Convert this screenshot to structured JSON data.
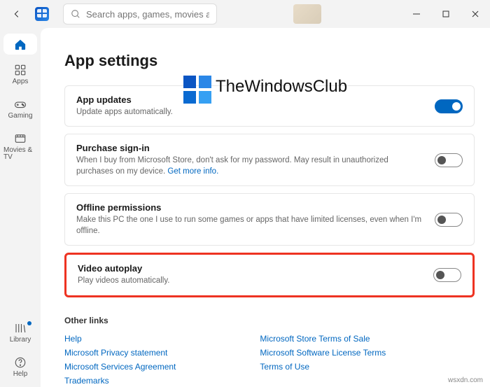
{
  "titlebar": {
    "search_placeholder": "Search apps, games, movies and more"
  },
  "sidebar": {
    "home": "Home",
    "apps": "Apps",
    "gaming": "Gaming",
    "movies": "Movies & TV",
    "library": "Library",
    "help": "Help"
  },
  "page": {
    "title": "App settings"
  },
  "settings": {
    "app_updates": {
      "title": "App updates",
      "desc": "Update apps automatically.",
      "on": true
    },
    "purchase": {
      "title": "Purchase sign-in",
      "desc_pre": "When I buy from Microsoft Store, don't ask for my password. May result in unauthorized purchases on my device. ",
      "link": "Get more info.",
      "on": false
    },
    "offline": {
      "title": "Offline permissions",
      "desc": "Make this PC the one I use to run some games or apps that have limited licenses, even when I'm offline.",
      "on": false
    },
    "video": {
      "title": "Video autoplay",
      "desc": "Play videos automatically.",
      "on": false
    }
  },
  "other_links": {
    "heading": "Other links",
    "left": [
      "Help",
      "Microsoft Privacy statement",
      "Microsoft Services Agreement",
      "Trademarks"
    ],
    "right": [
      "Microsoft Store Terms of Sale",
      "Microsoft Software License Terms",
      "Terms of Use"
    ]
  },
  "watermark": {
    "text": "TheWindowsClub",
    "corner": "wsxdn.com"
  }
}
